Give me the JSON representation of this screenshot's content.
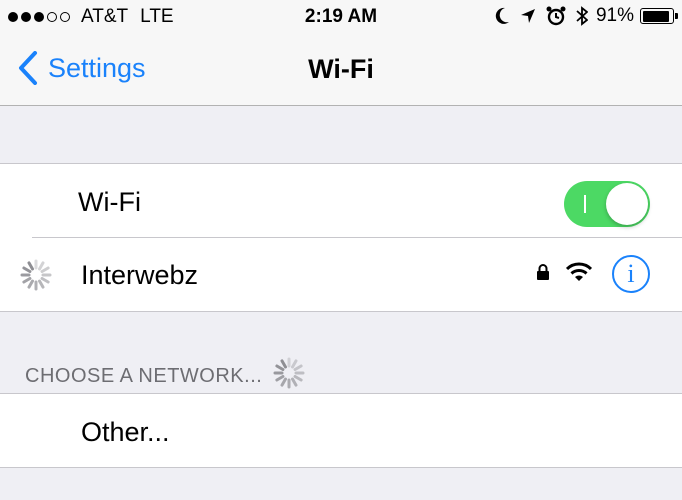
{
  "status_bar": {
    "carrier": "AT&T",
    "network": "LTE",
    "time": "2:19 AM",
    "battery_percent": "91%",
    "battery_level": 0.91,
    "signal_bars_filled": 3,
    "signal_bars_total": 5,
    "icons": [
      "moon-icon",
      "location-arrow-icon",
      "alarm-clock-icon",
      "bluetooth-icon",
      "battery-icon"
    ]
  },
  "nav": {
    "back_label": "Settings",
    "title": "Wi-Fi"
  },
  "wifi_toggle": {
    "label": "Wi-Fi",
    "on": true
  },
  "connected_network": {
    "name": "Interwebz",
    "secured": true,
    "icons": [
      "spinner-icon",
      "lock-icon",
      "wifi-signal-icon",
      "info-icon"
    ],
    "info_glyph": "i"
  },
  "networks_section": {
    "header": "CHOOSE A NETWORK...",
    "other_label": "Other..."
  },
  "colors": {
    "accent": "#1a82fb",
    "toggle_on": "#4cd964",
    "background": "#efeff4",
    "bar_background": "#f7f7f7",
    "section_text": "#6d6d72"
  }
}
